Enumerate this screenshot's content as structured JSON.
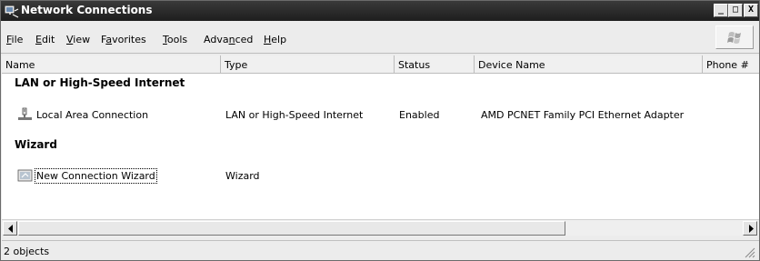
{
  "window": {
    "title": "Network Connections"
  },
  "titlebar_buttons": {
    "minimize": "_",
    "maximize": "□",
    "close": "X"
  },
  "menu": [
    {
      "label": "File",
      "accel": "F",
      "rest": "ile"
    },
    {
      "label": "Edit",
      "accel": "E",
      "rest": "dit"
    },
    {
      "label": "View",
      "accel": "V",
      "rest": "iew"
    },
    {
      "label": "Favorites",
      "pre": "F",
      "accel": "a",
      "rest": "vorites"
    },
    {
      "label": "Tools",
      "accel": "T",
      "rest": "ools"
    },
    {
      "label": "Advanced",
      "pre": "Adva",
      "accel": "n",
      "rest": "ced"
    },
    {
      "label": "Help",
      "accel": "H",
      "rest": "elp"
    }
  ],
  "columns": [
    "Name",
    "Type",
    "Status",
    "Device Name",
    "Phone #"
  ],
  "groups": [
    {
      "title": "LAN or High-Speed Internet",
      "items": [
        {
          "name": "Local Area Connection",
          "type": "LAN or High-Speed Internet",
          "status": "Enabled",
          "device": "AMD PCNET Family PCI Ethernet Adapter",
          "icon": "lan-connection-icon"
        }
      ]
    },
    {
      "title": "Wizard",
      "items": [
        {
          "name": "New Connection Wizard",
          "type": "Wizard",
          "status": "",
          "device": "",
          "icon": "wizard-icon"
        }
      ]
    }
  ],
  "status": {
    "text": "2 objects"
  }
}
